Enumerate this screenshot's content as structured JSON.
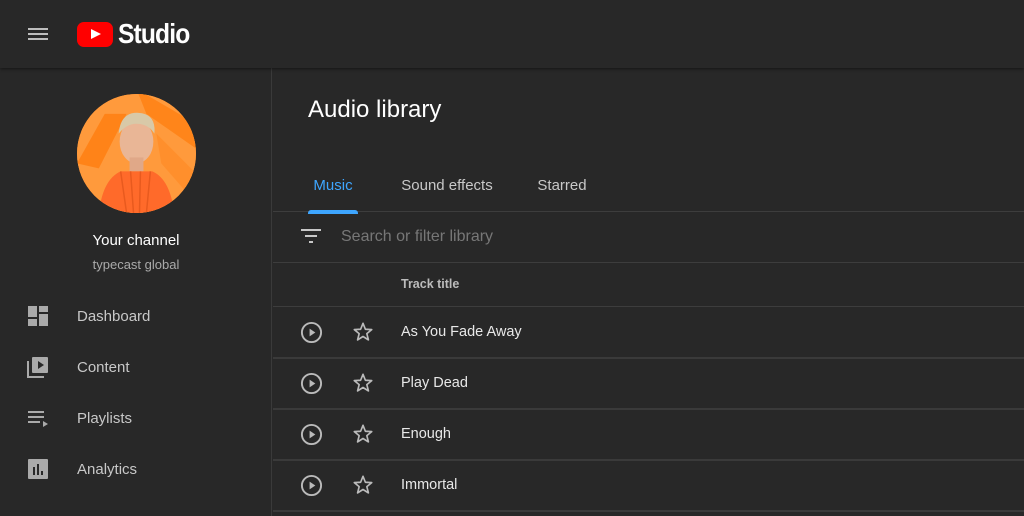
{
  "app": {
    "logo_text": "Studio",
    "menu_icon": "hamburger-menu-icon",
    "brand_color": "#ff0000"
  },
  "channel": {
    "title": "Your channel",
    "name": "typecast global"
  },
  "sidebar": {
    "items": [
      {
        "label": "Dashboard",
        "icon": "dashboard-icon"
      },
      {
        "label": "Content",
        "icon": "content-icon"
      },
      {
        "label": "Playlists",
        "icon": "playlists-icon"
      },
      {
        "label": "Analytics",
        "icon": "analytics-icon"
      }
    ]
  },
  "main": {
    "title": "Audio library",
    "tabs": [
      {
        "label": "Music",
        "active": true
      },
      {
        "label": "Sound effects",
        "active": false
      },
      {
        "label": "Starred",
        "active": false
      }
    ],
    "accent_color": "#3ea6ff",
    "search": {
      "placeholder": "Search or filter library",
      "value": ""
    },
    "table": {
      "columns": [
        "Track title"
      ],
      "rows": [
        {
          "title": "As You Fade Away",
          "starred": false
        },
        {
          "title": "Play Dead",
          "starred": false
        },
        {
          "title": "Enough",
          "starred": false
        },
        {
          "title": "Immortal",
          "starred": false
        }
      ]
    }
  }
}
